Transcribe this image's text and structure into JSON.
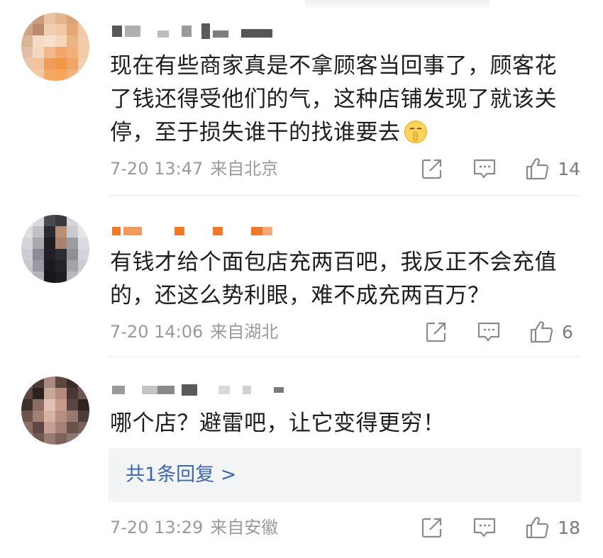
{
  "comments": [
    {
      "text_lines": [
        "现在有些商家真是不拿顾客当回事了，顾客花",
        "了钱还得受他们的气，这种店铺发现了就该关",
        "停，至于损失谁干的找谁要去"
      ],
      "emoji": "shushing-face-emoji",
      "time": "7-20 13:47",
      "location": "来自北京",
      "likes": "14"
    },
    {
      "text_lines": [
        "有钱才给个面包店充两百吧，我反正不会充值",
        "的，还这么势利眼，难不成充两百万？"
      ],
      "time": "7-20 14:06",
      "location": "来自湖北",
      "likes": "6"
    },
    {
      "text_lines": [
        "哪个店？避雷吧，让它变得更穷！"
      ],
      "replies_link": "共1条回复 >",
      "time": "7-20 13:29",
      "location": "来自安徽",
      "likes": "18"
    }
  ],
  "colors": {
    "text": "#1e1e1e",
    "meta": "#9a9a9a",
    "link": "#3d67b0",
    "reply_bg": "#f3f4f6",
    "username_orange": "#f07a2a"
  },
  "icons": {
    "share": "share-icon",
    "reply": "comment-icon",
    "like": "thumbs-up-icon"
  }
}
